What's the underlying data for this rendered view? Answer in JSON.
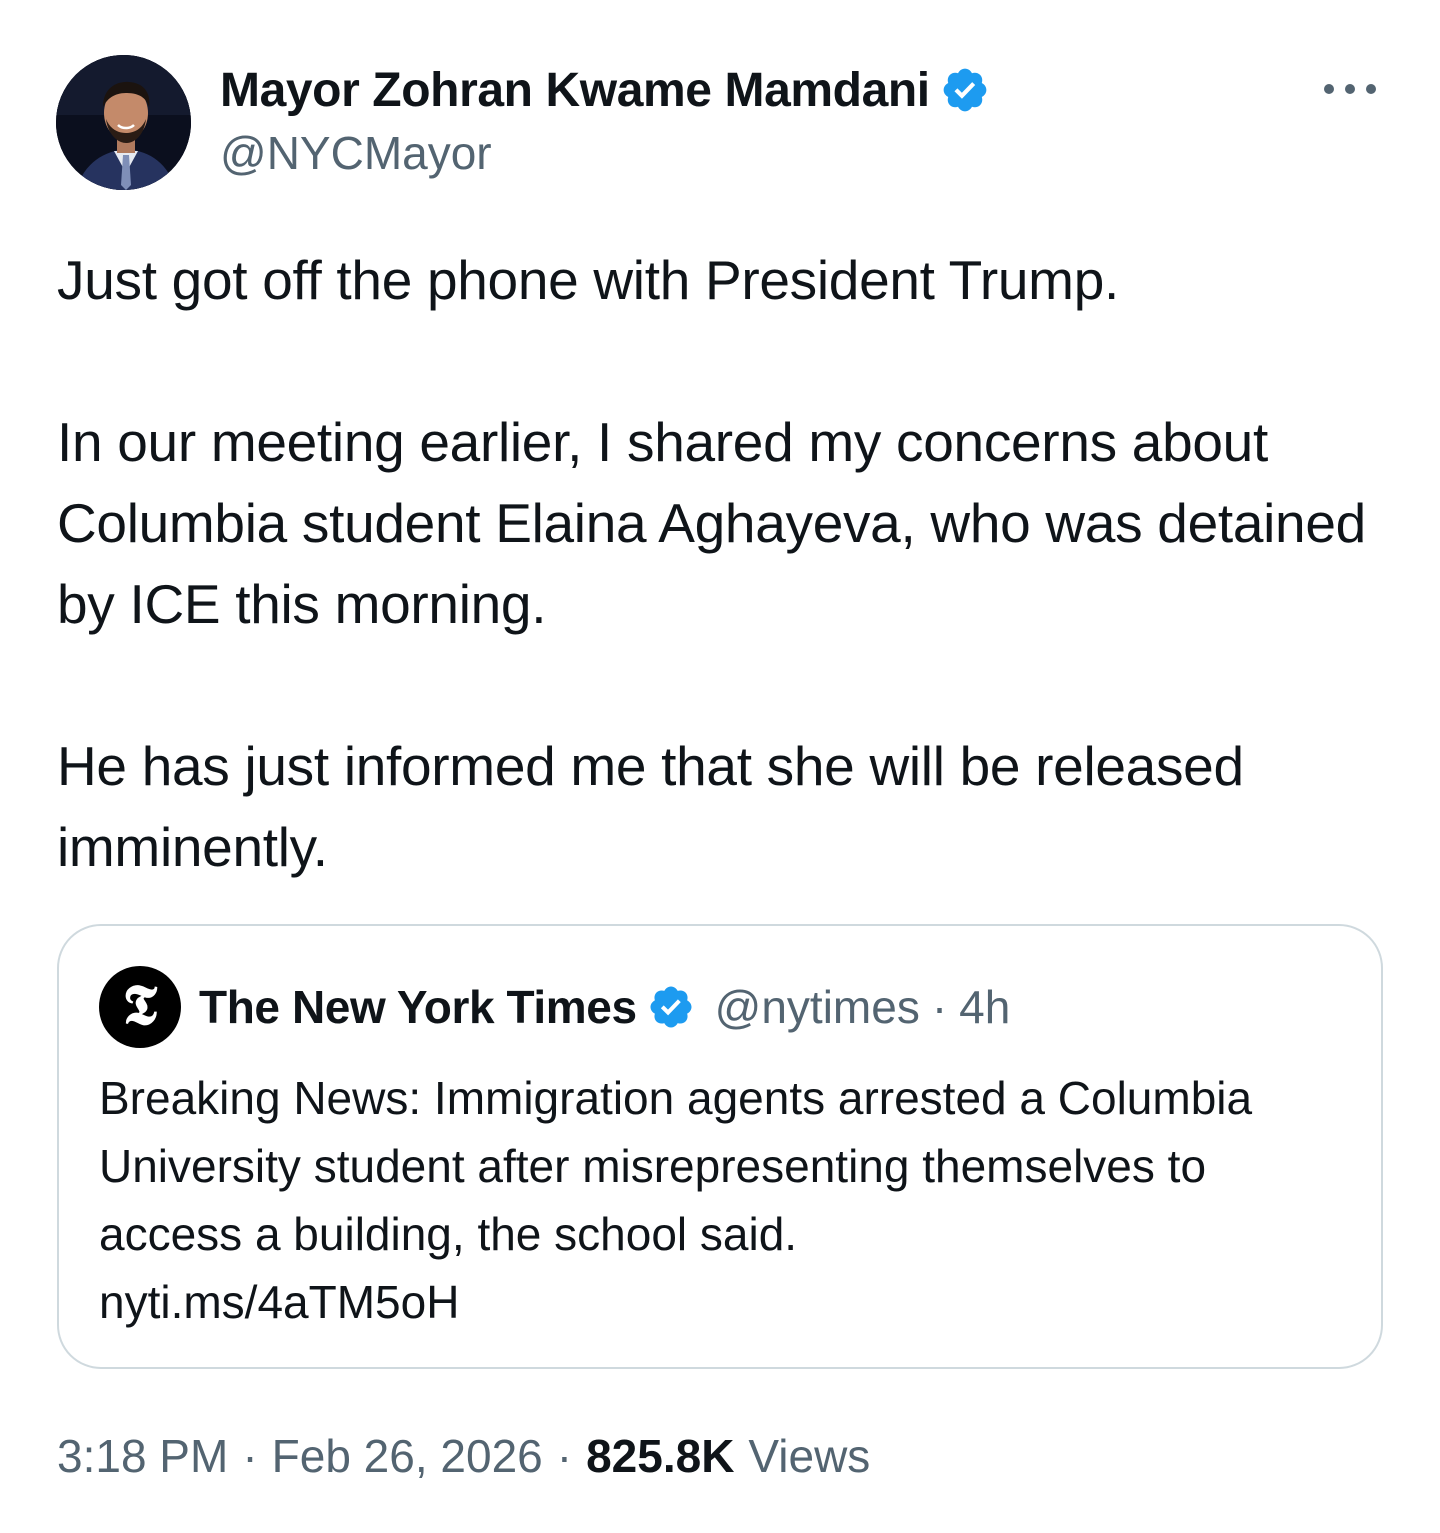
{
  "author": {
    "display_name": "Mayor Zohran Kwame Mamdani",
    "handle": "@NYCMayor",
    "verified": true,
    "avatar_icon": "profile-photo"
  },
  "more_icon": "more-horizontal-icon",
  "tweet": {
    "paragraphs": [
      "Just got off the phone with President Trump.",
      "In our meeting earlier, I shared my concerns about Columbia student Elaina Aghayeva, who was detained by ICE this morning.",
      "He has just informed me that she will be released imminently."
    ]
  },
  "quoted_tweet": {
    "logo_glyph": "𝕿",
    "display_name": "The New York Times",
    "verified": true,
    "handle": "@nytimes",
    "separator": "·",
    "time": "4h",
    "text": "Breaking News: Immigration agents arrested a Columbia University student after misrepresenting themselves to access a building, the school said.",
    "link": "nyti.ms/4aTM5oH"
  },
  "meta": {
    "time": "3:18 PM",
    "separator": "·",
    "date": "Feb 26, 2026",
    "views_count": "825.8K",
    "views_label": "Views"
  },
  "colors": {
    "text_primary": "#0f1419",
    "text_secondary": "#536471",
    "verified_blue": "#1d9bf0",
    "border": "#cfd9de"
  }
}
